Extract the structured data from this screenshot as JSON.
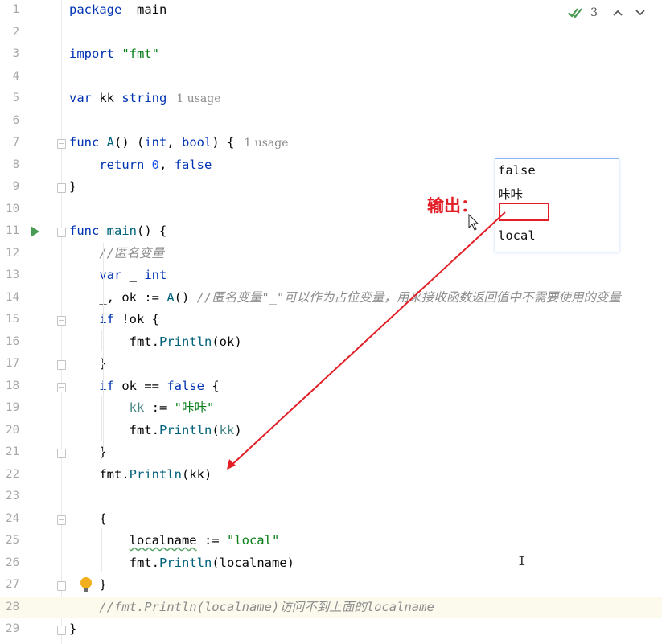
{
  "editor": {
    "top_right": {
      "check_count": "3"
    },
    "lines": [
      {
        "n": "1",
        "tokens": [
          [
            "kw",
            "package"
          ],
          [
            "",
            "  "
          ],
          [
            "pkg",
            "main"
          ]
        ]
      },
      {
        "n": "2",
        "tokens": []
      },
      {
        "n": "3",
        "tokens": [
          [
            "kw",
            "import"
          ],
          [
            "",
            " "
          ],
          [
            "str",
            "\"fmt\""
          ]
        ]
      },
      {
        "n": "4",
        "tokens": []
      },
      {
        "n": "5",
        "tokens": [
          [
            "kw",
            "var"
          ],
          [
            "",
            " kk "
          ],
          [
            "kw",
            "string"
          ],
          [
            "hint",
            "1 usage"
          ]
        ]
      },
      {
        "n": "6",
        "tokens": []
      },
      {
        "n": "7",
        "tokens": [
          [
            "kw",
            "func"
          ],
          [
            "",
            " "
          ],
          [
            "fn",
            "A"
          ],
          [
            "",
            "() ("
          ],
          [
            "kw",
            "int"
          ],
          [
            "",
            ", "
          ],
          [
            "kw",
            "bool"
          ],
          [
            "",
            ") {"
          ],
          [
            "hint",
            "1 usage"
          ]
        ]
      },
      {
        "n": "8",
        "tokens": [
          [
            "",
            "    "
          ],
          [
            "kw",
            "return"
          ],
          [
            "",
            " "
          ],
          [
            "num",
            "0"
          ],
          [
            "",
            ", "
          ],
          [
            "kw",
            "false"
          ]
        ]
      },
      {
        "n": "9",
        "tokens": [
          [
            "",
            "}"
          ]
        ]
      },
      {
        "n": "10",
        "tokens": []
      },
      {
        "n": "11",
        "tokens": [
          [
            "kw",
            "func"
          ],
          [
            "",
            " "
          ],
          [
            "fn",
            "main"
          ],
          [
            "",
            "() {"
          ]
        ]
      },
      {
        "n": "12",
        "tokens": [
          [
            "",
            "    "
          ],
          [
            "cmt",
            "//匿名变量"
          ]
        ]
      },
      {
        "n": "13",
        "tokens": [
          [
            "",
            "    "
          ],
          [
            "kw",
            "var"
          ],
          [
            "",
            " _ "
          ],
          [
            "kw",
            "int"
          ]
        ]
      },
      {
        "n": "14",
        "tokens": [
          [
            "",
            "    _, ok := "
          ],
          [
            "fn",
            "A"
          ],
          [
            "",
            "() "
          ],
          [
            "cmt",
            "//匿名变量\"_\"可以作为占位变量，用来接收函数返回值中不需要使用的变量"
          ]
        ]
      },
      {
        "n": "15",
        "tokens": [
          [
            "",
            "    "
          ],
          [
            "kw",
            "if"
          ],
          [
            "",
            " !ok {"
          ]
        ]
      },
      {
        "n": "16",
        "tokens": [
          [
            "",
            "        "
          ],
          [
            "pkg",
            "fmt"
          ],
          [
            "",
            "."
          ],
          [
            "fn",
            "Println"
          ],
          [
            "",
            "(ok)"
          ]
        ]
      },
      {
        "n": "17",
        "tokens": [
          [
            "",
            "    }"
          ]
        ]
      },
      {
        "n": "18",
        "tokens": [
          [
            "",
            "    "
          ],
          [
            "kw",
            "if"
          ],
          [
            "",
            " ok == "
          ],
          [
            "kw",
            "false"
          ],
          [
            "",
            " {"
          ]
        ]
      },
      {
        "n": "19",
        "tokens": [
          [
            "",
            "        "
          ],
          [
            "lvar",
            "kk"
          ],
          [
            "",
            " := "
          ],
          [
            "str",
            "\"咔咔\""
          ]
        ]
      },
      {
        "n": "20",
        "tokens": [
          [
            "",
            "        "
          ],
          [
            "pkg",
            "fmt"
          ],
          [
            "",
            "."
          ],
          [
            "fn",
            "Println"
          ],
          [
            "",
            "("
          ],
          [
            "lvar",
            "kk"
          ],
          [
            "",
            ")"
          ]
        ]
      },
      {
        "n": "21",
        "tokens": [
          [
            "",
            "    }"
          ]
        ]
      },
      {
        "n": "22",
        "tokens": [
          [
            "",
            "    "
          ],
          [
            "pkg",
            "fmt"
          ],
          [
            "",
            "."
          ],
          [
            "fn",
            "Println"
          ],
          [
            "",
            "(kk)"
          ]
        ]
      },
      {
        "n": "23",
        "tokens": []
      },
      {
        "n": "24",
        "tokens": [
          [
            "",
            "    {"
          ]
        ]
      },
      {
        "n": "25",
        "tokens": [
          [
            "",
            "        "
          ],
          [
            "squig",
            "localname"
          ],
          [
            "",
            " := "
          ],
          [
            "str",
            "\"local\""
          ]
        ]
      },
      {
        "n": "26",
        "tokens": [
          [
            "",
            "        "
          ],
          [
            "pkg",
            "fmt"
          ],
          [
            "",
            "."
          ],
          [
            "fn",
            "Println"
          ],
          [
            "",
            "(localname)"
          ]
        ]
      },
      {
        "n": "27",
        "tokens": [
          [
            "",
            "    }"
          ]
        ]
      },
      {
        "n": "28",
        "tokens": [
          [
            "",
            "    "
          ],
          [
            "cmt",
            "//fmt.Println(localname)访问不到上面的localname"
          ]
        ]
      },
      {
        "n": "29",
        "tokens": [
          [
            "",
            "}"
          ]
        ]
      }
    ]
  },
  "annotation": {
    "label": "输出：",
    "output_lines": [
      "false",
      "咔咔",
      "",
      "local"
    ]
  },
  "colors": {
    "keyword": "#0033b3",
    "function": "#00627a",
    "string": "#067d17",
    "comment": "#8c8c8c",
    "annotation_red": "#e21f26",
    "run_green": "#499c54"
  }
}
